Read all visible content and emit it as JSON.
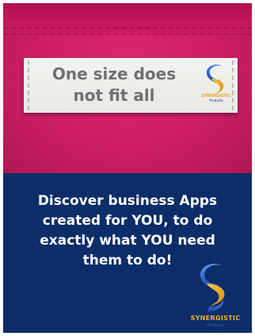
{
  "label": {
    "line1": "One size does",
    "line2": "not fit all"
  },
  "brand": {
    "name": "SYNERGISTIC",
    "tagline": "Products"
  },
  "headline": {
    "line1": "Discover business Apps",
    "line2": "created for YOU, to do",
    "line3": "exactly what YOU need",
    "line4": "them to do!"
  },
  "colors": {
    "fabric": "#cf1a62",
    "panel": "#0c2d68",
    "logo_gold": "#f0b324",
    "logo_blue": "#2f6fd6"
  },
  "icons": {
    "logo": "synergistic-s-logo-icon"
  }
}
